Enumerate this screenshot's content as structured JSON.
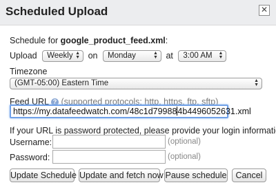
{
  "dialog": {
    "title": "Scheduled Upload",
    "close_glyph": "✕"
  },
  "schedule": {
    "prefix": "Schedule for ",
    "filename": "google_product_feed.xml",
    "suffix": ":"
  },
  "upload": {
    "label": "Upload",
    "frequency": "Weekly",
    "on_label": "on",
    "day": "Monday",
    "at_label": "at",
    "time": "3:00 AM"
  },
  "timezone": {
    "label": "Timezone",
    "value": "(GMT-05:00) Eastern Time"
  },
  "feed_url": {
    "label": "Feed URL",
    "help_glyph": "?",
    "supported": "(supported protocols: http, https, ftp, sftp)",
    "value_before_caret": "https://my.datafeedwatch.com/48c1d79988",
    "value_after_caret": "4b4496052631.xml"
  },
  "login": {
    "note": "If your URL is password protected, please provide your login information.",
    "username_label": "Username:",
    "password_label": "Password:",
    "optional": "(optional)"
  },
  "buttons": {
    "update_schedule": "Update Schedule",
    "update_fetch": "Update and fetch now",
    "pause": "Pause schedule",
    "cancel": "Cancel"
  }
}
